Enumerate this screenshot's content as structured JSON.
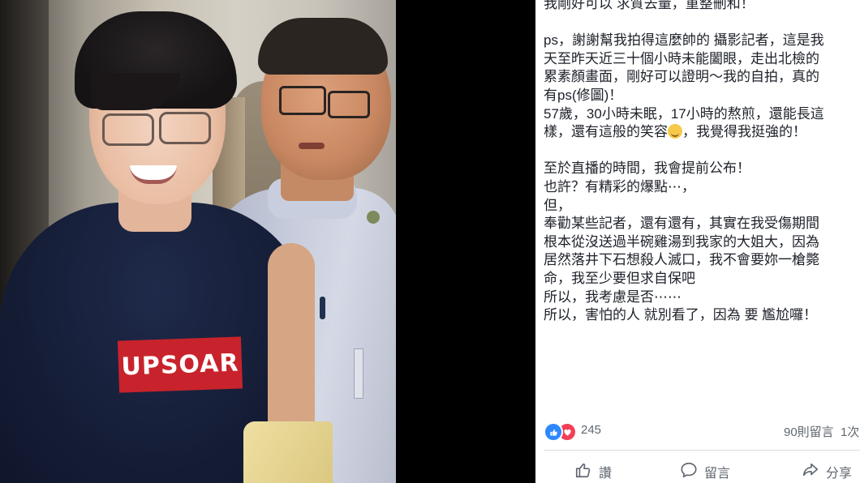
{
  "photo": {
    "shirt_text": "UPSOAR"
  },
  "post": {
    "lines": [
      "我剛好可以 求質去量，重整刪和！",
      "",
      "ps，謝謝幫我拍得這麼帥的 攝影記者，這是我",
      "天至昨天近三十個小時未能闔眼，走出北檢的",
      "累素顏畫面，剛好可以證明～我的自拍，真的",
      "有ps(修圖)！",
      "57歲，30小時未眠，17小時的熬煎，還能長這",
      "",
      "",
      "至於直播的時間，我會提前公布！",
      "也許？有精彩的爆點⋯，",
      "但，",
      "奉勸某些記者，還有還有，其實在我受傷期間",
      "根本從沒送過半碗雞湯到我家的大姐大，因為",
      "居然落井下石想殺人滅口，我不會要妳一槍斃",
      "命，我至少要但求自保吧",
      "所以，我考慮是否⋯⋯",
      "所以，害怕的人 就別看了，因為 要 尷尬囉！"
    ],
    "emoji_line_before": "樣，還有這般的笑容",
    "emoji_line_after": "，我覺得我挺強的！"
  },
  "reactions": {
    "count": "245",
    "comments": "90則留言",
    "shares": "1次"
  },
  "actions": {
    "like": "讚",
    "comment": "留言",
    "share": "分享"
  },
  "colors": {
    "like_blue": "#2d88ff",
    "love_red": "#f33e58",
    "shirt_red": "#c8232c"
  }
}
